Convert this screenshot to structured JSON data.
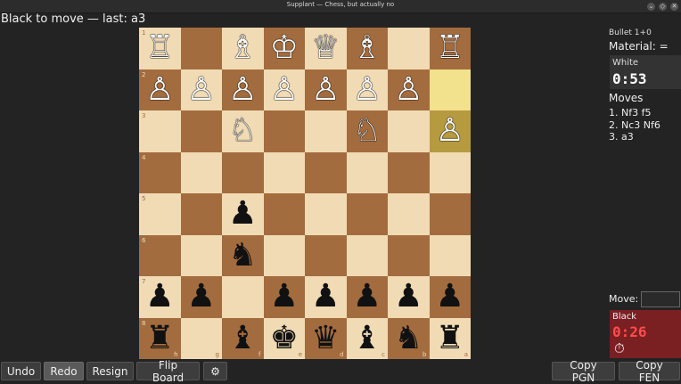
{
  "window": {
    "title": "Supplant — Chess, but actually no",
    "controls": [
      "⌄",
      "◇",
      "✕"
    ]
  },
  "status": "Black to move  —  last: a3",
  "board": {
    "ranks": [
      "1",
      "2",
      "3",
      "4",
      "5",
      "6",
      "7",
      "8"
    ],
    "files": [
      "h",
      "g",
      "f",
      "e",
      "d",
      "c",
      "b",
      "a"
    ],
    "rows": [
      [
        "♖",
        "",
        "♗",
        "♔",
        "♕",
        "♗",
        "",
        "♖"
      ],
      [
        "♙",
        "♙",
        "♙",
        "♙",
        "♙",
        "♙",
        "♙",
        ""
      ],
      [
        "",
        "",
        "♘",
        "",
        "",
        "♘",
        "",
        "♙"
      ],
      [
        "",
        "",
        "",
        "",
        "",
        "",
        "",
        ""
      ],
      [
        "",
        "",
        "♟",
        "",
        "",
        "",
        "",
        ""
      ],
      [
        "",
        "",
        "♞",
        "",
        "",
        "",
        "",
        ""
      ],
      [
        "♟",
        "♟",
        "",
        "♟",
        "♟",
        "♟",
        "♟",
        "♟"
      ],
      [
        "♜",
        "",
        "♝",
        "♚",
        "♛",
        "♝",
        "♞",
        "♜"
      ]
    ],
    "colors": [
      [
        "w",
        "",
        "w",
        "w",
        "w",
        "w",
        "",
        "w"
      ],
      [
        "w",
        "w",
        "w",
        "w",
        "w",
        "w",
        "w",
        ""
      ],
      [
        "",
        "",
        "w",
        "",
        "",
        "w",
        "",
        "w"
      ],
      [
        "",
        "",
        "",
        "",
        "",
        "",
        "",
        ""
      ],
      [
        "",
        "",
        "b",
        "",
        "",
        "",
        "",
        ""
      ],
      [
        "",
        "",
        "b",
        "",
        "",
        "",
        "",
        ""
      ],
      [
        "b",
        "b",
        "",
        "b",
        "b",
        "b",
        "b",
        "b"
      ],
      [
        "b",
        "",
        "b",
        "b",
        "b",
        "b",
        "b",
        "b"
      ]
    ],
    "highlight_from": [
      1,
      7
    ],
    "highlight_to": [
      2,
      7
    ]
  },
  "panel": {
    "time_control": "Bullet 1+0",
    "material": "Material: =",
    "white_label": "White",
    "white_time": "0:53",
    "moves_heading": "Moves",
    "moves": [
      "1. Nf3 f5",
      "2. Nc3 Nf6",
      "3. a3"
    ],
    "move_label": "Move:",
    "move_value": "",
    "black_label": "Black",
    "black_time": "0:26",
    "stopwatch_icon": "⏱"
  },
  "buttons": {
    "undo": "Undo",
    "redo": "Redo",
    "resign": "Resign",
    "flip": "Flip Board",
    "settings": "⚙",
    "copy_pgn": "Copy PGN",
    "copy_fen": "Copy FEN"
  }
}
